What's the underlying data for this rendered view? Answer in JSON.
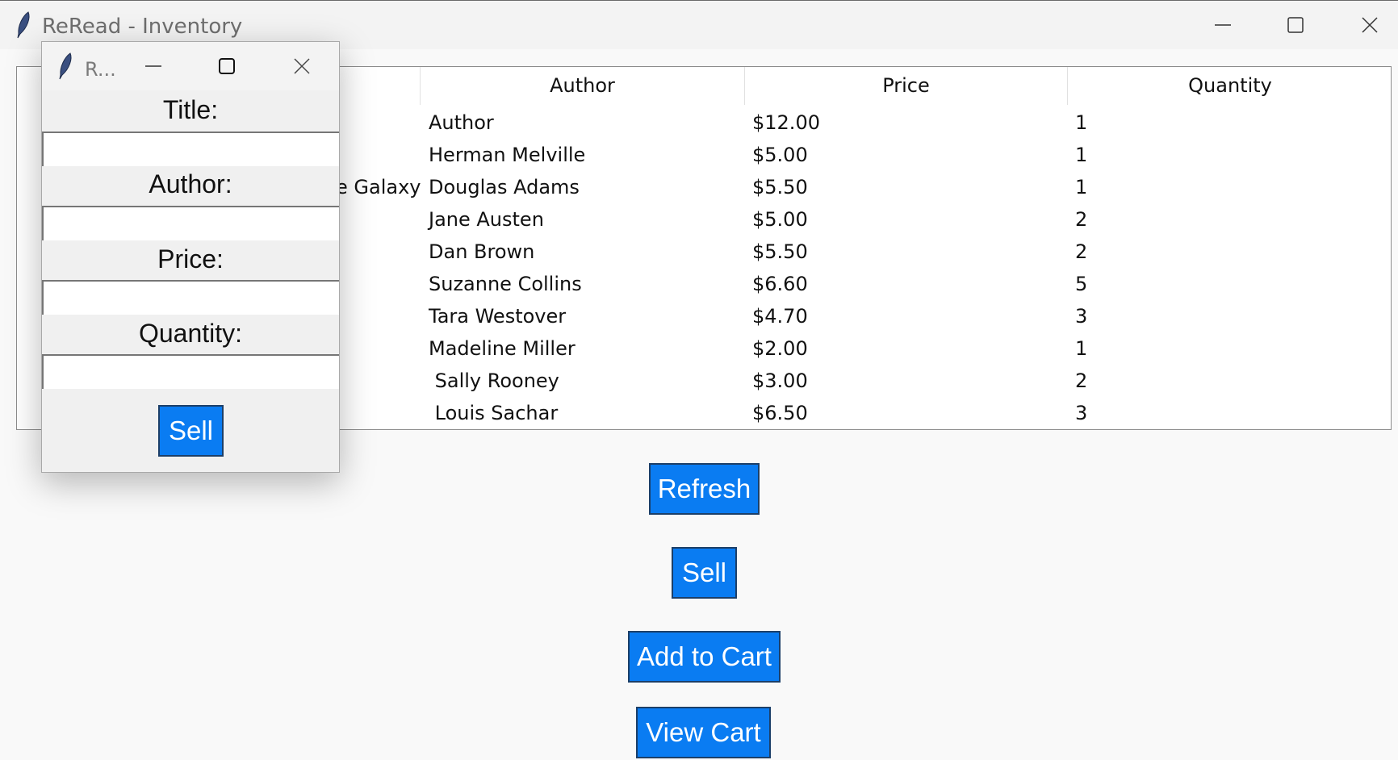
{
  "main_window": {
    "title": "ReRead - Inventory",
    "icon": "feather-icon",
    "controls": [
      "minimize-icon",
      "maximize-icon",
      "close-icon"
    ]
  },
  "table": {
    "columns": [
      "",
      "Author",
      "Price",
      "Quantity"
    ],
    "rows": [
      {
        "title": "",
        "author": "Author",
        "price": "$12.00",
        "quantity": "1"
      },
      {
        "title": "",
        "author": "Herman Melville",
        "price": "$5.00",
        "quantity": "1"
      },
      {
        "title": "e Galaxy",
        "author": "Douglas Adams",
        "price": "$5.50",
        "quantity": "1"
      },
      {
        "title": "",
        "author": "Jane Austen",
        "price": "$5.00",
        "quantity": "2"
      },
      {
        "title": "",
        "author": "Dan Brown",
        "price": "$5.50",
        "quantity": "2"
      },
      {
        "title": "",
        "author": "Suzanne Collins",
        "price": "$6.60",
        "quantity": "5"
      },
      {
        "title": "",
        "author": "Tara Westover",
        "price": "$4.70",
        "quantity": "3"
      },
      {
        "title": "",
        "author": "Madeline Miller",
        "price": "$2.00",
        "quantity": "1"
      },
      {
        "title": "",
        "author": " Sally Rooney",
        "price": "$3.00",
        "quantity": "2"
      },
      {
        "title": "",
        "author": " Louis Sachar",
        "price": "$6.50",
        "quantity": "3"
      }
    ]
  },
  "buttons": {
    "refresh": "Refresh",
    "sell": "Sell",
    "add_to_cart": "Add to Cart",
    "view_cart": "View Cart"
  },
  "dialog": {
    "title": "R...",
    "title_label": "Title:",
    "title_value": "",
    "author_label": "Author:",
    "author_value": "",
    "price_label": "Price:",
    "price_value": "",
    "quantity_label": "Quantity:",
    "quantity_value": "",
    "sell_button": "Sell"
  },
  "colors": {
    "button_bg": "#0a7cf2",
    "button_text": "#ffffff",
    "window_bg": "#f9f9f9"
  }
}
